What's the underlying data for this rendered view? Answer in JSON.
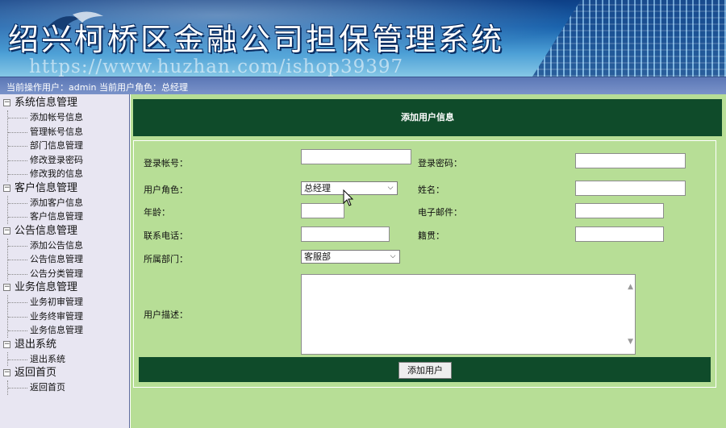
{
  "banner": {
    "title": "绍兴柯桥区金融公司担保管理系统",
    "watermark": "https://www.huzhan.com/ishop39397"
  },
  "status": {
    "text": "当前操作用户：admin 当前用户角色：总经理"
  },
  "sidebar": {
    "groups": [
      {
        "label": "系统信息管理",
        "items": [
          "添加帐号信息",
          "管理帐号信息",
          "部门信息管理",
          "修改登录密码",
          "修改我的信息"
        ]
      },
      {
        "label": "客户信息管理",
        "items": [
          "添加客户信息",
          "客户信息管理"
        ]
      },
      {
        "label": "公告信息管理",
        "items": [
          "添加公告信息",
          "公告信息管理",
          "公告分类管理"
        ]
      },
      {
        "label": "业务信息管理",
        "items": [
          "业务初审管理",
          "业务终审管理",
          "业务信息管理"
        ]
      },
      {
        "label": "退出系统",
        "items": [
          "退出系统"
        ]
      },
      {
        "label": "返回首页",
        "items": [
          "返回首页"
        ]
      }
    ]
  },
  "form": {
    "title": "添加用户信息",
    "login_account_label": "登录帐号：",
    "login_password_label": "登录密码：",
    "role_label": "用户角色：",
    "role_value": "总经理",
    "name_label": "姓名：",
    "age_label": "年龄：",
    "email_label": "电子邮件：",
    "phone_label": "联系电话：",
    "hometown_label": "籍贯：",
    "department_label": "所属部门：",
    "department_value": "客服部",
    "description_label": "用户描述：",
    "submit_label": "添加用户"
  }
}
